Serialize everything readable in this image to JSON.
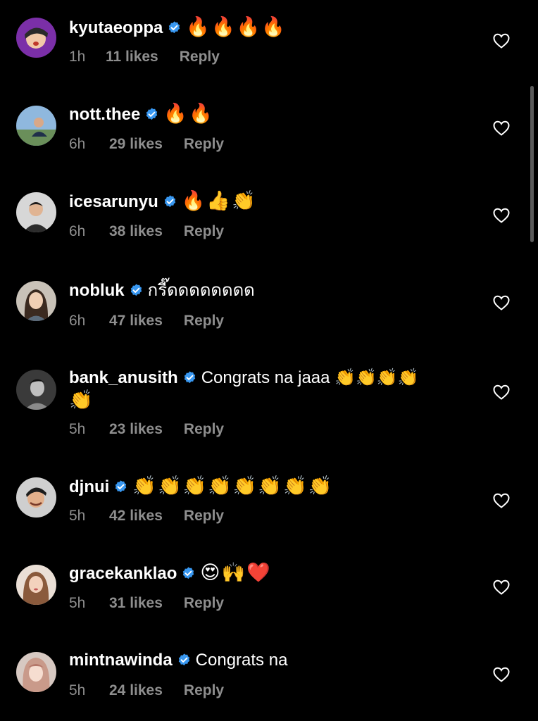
{
  "comments": [
    {
      "username": "kyutaeoppa",
      "text": "🔥🔥🔥🔥",
      "continuation": "",
      "time": "1h",
      "likes": "11 likes",
      "reply": "Reply"
    },
    {
      "username": "nott.thee",
      "text": "🔥🔥",
      "continuation": "",
      "time": "6h",
      "likes": "29 likes",
      "reply": "Reply"
    },
    {
      "username": "icesarunyu",
      "text": "🔥👍👏",
      "continuation": "",
      "time": "6h",
      "likes": "38 likes",
      "reply": "Reply"
    },
    {
      "username": "nobluk",
      "text": "กรี๊ดดดดดดดด",
      "continuation": "",
      "time": "6h",
      "likes": "47 likes",
      "reply": "Reply"
    },
    {
      "username": "bank_anusith",
      "text": "Congrats na jaaa 👏👏👏👏",
      "continuation": "👏",
      "time": "5h",
      "likes": "23 likes",
      "reply": "Reply"
    },
    {
      "username": "djnui",
      "text": "👏👏👏👏👏👏👏👏",
      "continuation": "",
      "time": "5h",
      "likes": "42 likes",
      "reply": "Reply"
    },
    {
      "username": "gracekanklao",
      "text": "😍🙌❤️",
      "continuation": "",
      "time": "5h",
      "likes": "31 likes",
      "reply": "Reply"
    },
    {
      "username": "mintnawinda",
      "text": "Congrats na",
      "continuation": "",
      "time": "5h",
      "likes": "24 likes",
      "reply": "Reply"
    }
  ],
  "colors": {
    "background": "#000000",
    "primary_text": "#ffffff",
    "secondary_text": "#8e8e8e",
    "verified_badge": "#3897f0"
  },
  "icons": {
    "verified": "verified-badge-icon",
    "like": "heart-outline-icon"
  }
}
